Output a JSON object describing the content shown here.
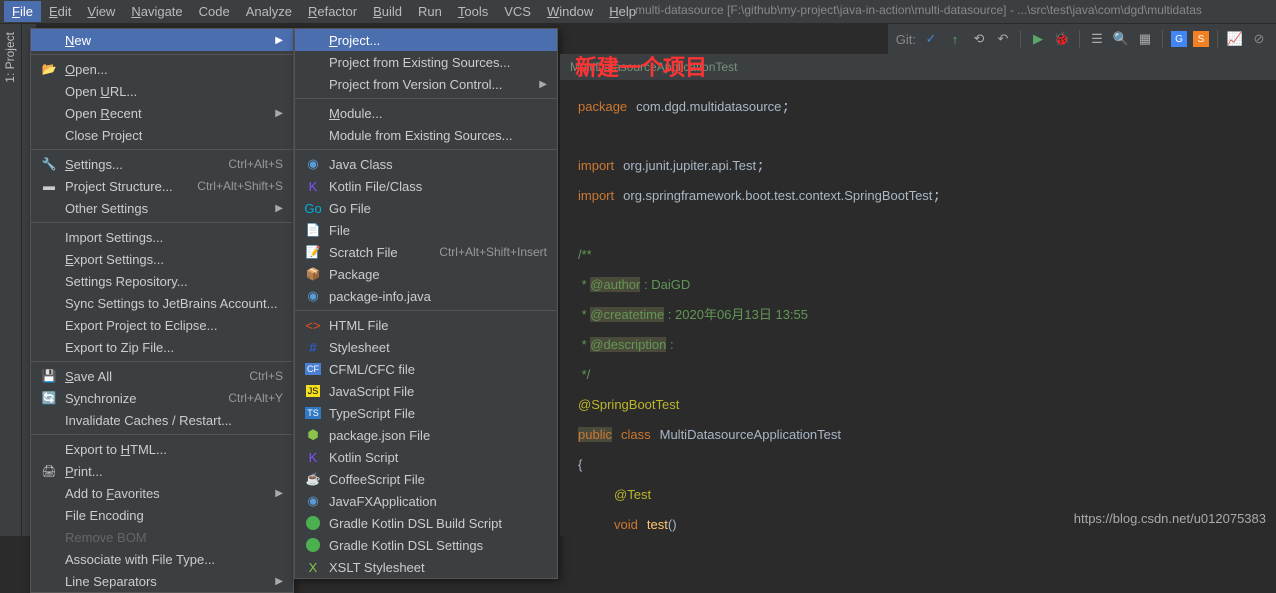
{
  "title": "multi-datasource [F:\\github\\my-project\\java-in-action\\multi-datasource] - ...\\src\\test\\java\\com\\dgd\\multidatas",
  "menubar": [
    "File",
    "Edit",
    "View",
    "Navigate",
    "Code",
    "Analyze",
    "Refactor",
    "Build",
    "Run",
    "Tools",
    "VCS",
    "Window",
    "Help"
  ],
  "menubar_u": [
    "F",
    "E",
    "V",
    "N",
    "",
    "",
    "R",
    "B",
    "",
    "T",
    "",
    "W",
    "H"
  ],
  "sidebar_label": "1: Project",
  "git_label": "Git:",
  "annotation": "新建一个项目",
  "editor_tab": "MultiDatasourceApplicationTest",
  "dropdown1": [
    {
      "label": "New",
      "u": "N",
      "arrow": true,
      "hl": true
    },
    {
      "sep": true
    },
    {
      "icon": "open",
      "label": "Open...",
      "u": "O"
    },
    {
      "label": "Open URL...",
      "u": "U"
    },
    {
      "label": "Open Recent",
      "u": "R",
      "arrow": true
    },
    {
      "label": "Close Project",
      "u": "j"
    },
    {
      "sep": true
    },
    {
      "icon": "settings",
      "label": "Settings...",
      "u": "S",
      "sc": "Ctrl+Alt+S"
    },
    {
      "icon": "structure",
      "label": "Project Structure...",
      "sc": "Ctrl+Alt+Shift+S"
    },
    {
      "label": "Other Settings",
      "arrow": true
    },
    {
      "sep": true
    },
    {
      "label": "Import Settings..."
    },
    {
      "label": "Export Settings...",
      "u": "E"
    },
    {
      "label": "Settings Repository..."
    },
    {
      "label": "Sync Settings to JetBrains Account..."
    },
    {
      "label": "Export Project to Eclipse..."
    },
    {
      "label": "Export to Zip File..."
    },
    {
      "sep": true
    },
    {
      "icon": "save",
      "label": "Save All",
      "u": "S",
      "sc": "Ctrl+S"
    },
    {
      "icon": "sync",
      "label": "Synchronize",
      "u": "y",
      "sc": "Ctrl+Alt+Y"
    },
    {
      "label": "Invalidate Caches / Restart..."
    },
    {
      "sep": true
    },
    {
      "label": "Export to HTML...",
      "u": "H"
    },
    {
      "icon": "print",
      "label": "Print...",
      "u": "P"
    },
    {
      "label": "Add to Favorites",
      "u": "F",
      "arrow": true
    },
    {
      "label": "File Encoding"
    },
    {
      "label": "Remove BOM",
      "disabled": true
    },
    {
      "label": "Associate with File Type..."
    },
    {
      "label": "Line Separators",
      "arrow": true
    }
  ],
  "dropdown2": [
    {
      "label": "Project...",
      "u": "P",
      "hl": true
    },
    {
      "label": "Project from Existing Sources..."
    },
    {
      "label": "Project from Version Control...",
      "arrow": true
    },
    {
      "sep": true
    },
    {
      "label": "Module...",
      "u": "M"
    },
    {
      "label": "Module from Existing Sources..."
    },
    {
      "sep": true
    },
    {
      "icon": "java",
      "label": "Java Class"
    },
    {
      "icon": "kotlin",
      "label": "Kotlin File/Class"
    },
    {
      "icon": "go",
      "label": "Go File"
    },
    {
      "icon": "file",
      "label": "File"
    },
    {
      "icon": "scratch",
      "label": "Scratch File",
      "sc": "Ctrl+Alt+Shift+Insert"
    },
    {
      "icon": "package",
      "label": "Package"
    },
    {
      "icon": "pkginfo",
      "label": "package-info.java"
    },
    {
      "sep": true
    },
    {
      "icon": "html",
      "label": "HTML File"
    },
    {
      "icon": "css",
      "label": "Stylesheet"
    },
    {
      "icon": "cfml",
      "label": "CFML/CFC file"
    },
    {
      "icon": "js",
      "label": "JavaScript File"
    },
    {
      "icon": "ts",
      "label": "TypeScript File"
    },
    {
      "icon": "pkgjson",
      "label": "package.json File"
    },
    {
      "icon": "kts",
      "label": "Kotlin Script"
    },
    {
      "icon": "coffee",
      "label": "CoffeeScript File"
    },
    {
      "icon": "jfx",
      "label": "JavaFXApplication"
    },
    {
      "icon": "gradle",
      "label": "Gradle Kotlin DSL Build Script"
    },
    {
      "icon": "gradle",
      "label": "Gradle Kotlin DSL Settings"
    },
    {
      "icon": "xslt",
      "label": "XSLT Stylesheet"
    }
  ],
  "code": {
    "l1_kw": "package",
    "l1_pkg": "com.dgd.multidatasource",
    "l3_kw": "import",
    "l3_pkg": "org.junit.jupiter.api.Test",
    "l4_kw": "import",
    "l4_pkg": "org.springframework.boot.test.context.SpringBootTest",
    "c1": "/**",
    "c2": " * ",
    "c2a": "@author",
    "c2b": " : DaiGD",
    "c3": " * ",
    "c3a": "@createtime",
    "c3b": " : 2020年06月13日 13:55",
    "c4": " * ",
    "c4a": "@description",
    "c4b": " :",
    "c5": " */",
    "anno": "@SpringBootTest",
    "mod": "public",
    "cls_kw": "class",
    "cls": "MultiDatasourceApplicationTest",
    "brace": "{",
    "test_anno": "@Test",
    "void": "void",
    "method": "test",
    "parens": "()"
  },
  "watermark": "https://blog.csdn.net/u012075383"
}
